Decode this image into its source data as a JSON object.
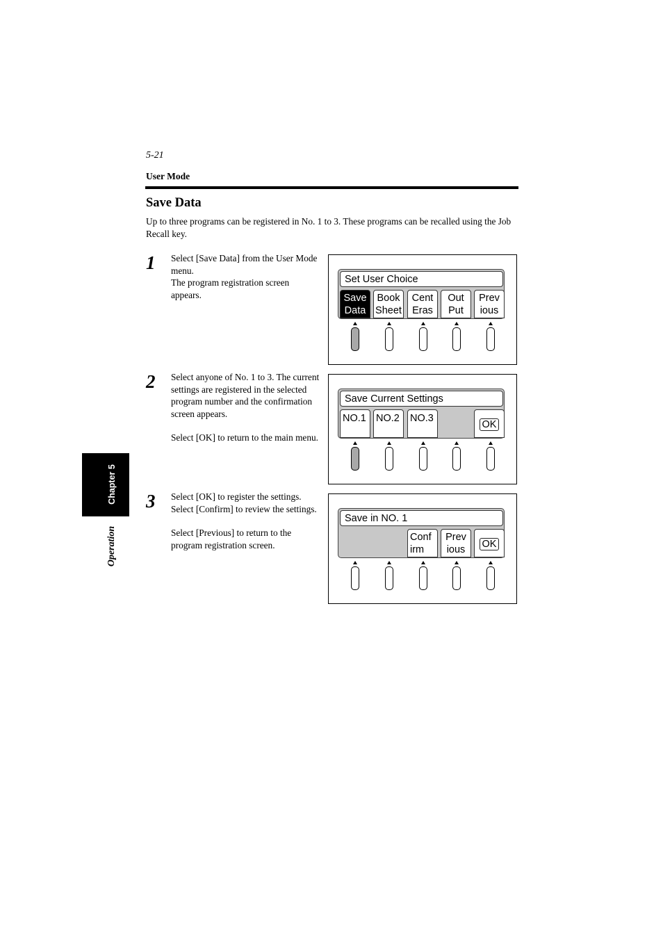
{
  "header": {
    "page_number": "5-21",
    "section": "User Mode"
  },
  "title": "Save Data",
  "intro": "Up to three programs can be registered in No. 1 to 3.  These programs can be recalled using the Job Recall key.",
  "side_tab": {
    "chapter": "Chapter 5",
    "part": "Operation"
  },
  "steps": [
    {
      "number": "1",
      "paragraphs": [
        "Select [Save Data] from the User Mode menu.",
        "The program registration screen appears."
      ]
    },
    {
      "number": "2",
      "paragraphs": [
        "Select anyone of No. 1 to 3.  The current settings are registered in the selected program number and the confirmation screen appears.",
        "Select [OK] to return to the main menu."
      ]
    },
    {
      "number": "3",
      "paragraphs": [
        "Select [OK] to register the settings. Select [Confirm] to review the settings.",
        "Select [Previous] to return to the program registration screen."
      ]
    }
  ],
  "screens": [
    {
      "title": "Set User Choice",
      "keys": [
        {
          "line1": "Save",
          "line2": "Data",
          "selected": true
        },
        {
          "line1": "Book",
          "line2": "Sheet"
        },
        {
          "line1": "Cent",
          "line2": "Eras"
        },
        {
          "line1": "Out",
          "line2": "Put"
        },
        {
          "line1": "Prev",
          "line2": "ious"
        }
      ],
      "pressed_button": 1
    },
    {
      "title": "Save Current Settings",
      "keys": [
        {
          "line1": "NO.1"
        },
        {
          "line1": "NO.2"
        },
        {
          "line1": "NO.3"
        },
        null,
        {
          "ok": "OK"
        }
      ],
      "pressed_button": 1
    },
    {
      "title": "Save in NO. 1",
      "keys": [
        null,
        null,
        {
          "line1": "Conf",
          "line2": "irm"
        },
        {
          "line1": "Prev",
          "line2": "ious"
        },
        {
          "ok": "OK"
        }
      ],
      "pressed_button": 0
    }
  ]
}
